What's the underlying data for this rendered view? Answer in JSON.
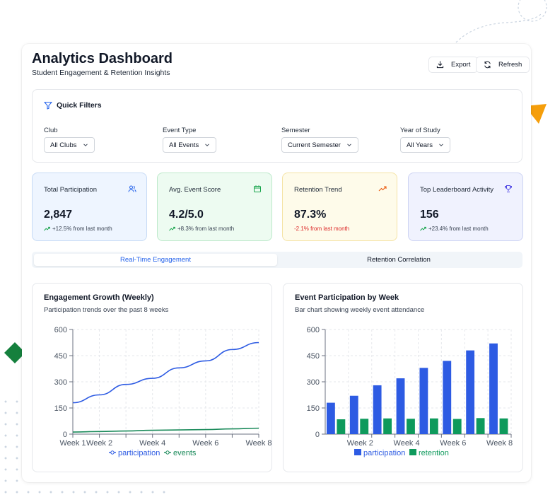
{
  "header": {
    "title": "Analytics Dashboard",
    "subtitle": "Student Engagement & Retention Insights",
    "export_label": "Export",
    "refresh_label": "Refresh"
  },
  "filters": {
    "title": "Quick Filters",
    "items": [
      {
        "label": "Club",
        "value": "All Clubs"
      },
      {
        "label": "Event Type",
        "value": "All Events"
      },
      {
        "label": "Semester",
        "value": "Current Semester"
      },
      {
        "label": "Year of Study",
        "value": "All Years"
      }
    ]
  },
  "metrics": [
    {
      "label": "Total Participation",
      "value": "2,847",
      "change": "+12.5% from last month",
      "icon": "users-icon",
      "trend": "up"
    },
    {
      "label": "Avg. Event Score",
      "value": "4.2/5.0",
      "change": "+8.3% from last month",
      "icon": "calendar-icon",
      "trend": "up"
    },
    {
      "label": "Retention Trend",
      "value": "87.3%",
      "change": "-2.1% from last month",
      "icon": "trending-up-icon",
      "trend": "down"
    },
    {
      "label": "Top Leaderboard Activity",
      "value": "156",
      "change": "+23.4% from last month",
      "icon": "trophy-icon",
      "trend": "up"
    }
  ],
  "tabs": [
    {
      "label": "Real-Time Engagement",
      "active": true
    },
    {
      "label": "Retention Correlation",
      "active": false
    }
  ],
  "colors": {
    "participation": "#2d5be3",
    "events": "#1a8a5a",
    "retention": "#0e9a5c",
    "accent": "#2563eb",
    "negative": "#dc2626"
  },
  "chart_data": [
    {
      "type": "line",
      "title": "Engagement Growth (Weekly)",
      "subtitle": "Participation trends over the past 8 weeks",
      "x": [
        "Week 1",
        "Week 2",
        "Week 3",
        "Week 4",
        "Week 5",
        "Week 6",
        "Week 7",
        "Week 8"
      ],
      "tick_labels": [
        "Week 1",
        "Week 2",
        "Week 4",
        "Week 6",
        "Week 8"
      ],
      "y_ticks": [
        "0",
        "150",
        "300",
        "450",
        "600"
      ],
      "ylim": [
        0,
        600
      ],
      "grid": true,
      "legend": "bottom",
      "series": [
        {
          "name": "participation",
          "values": [
            180,
            225,
            285,
            320,
            380,
            420,
            485,
            525
          ]
        },
        {
          "name": "events",
          "values": [
            12,
            15,
            18,
            22,
            24,
            26,
            30,
            34
          ]
        }
      ]
    },
    {
      "type": "bar",
      "title": "Event Participation by Week",
      "subtitle": "Bar chart showing weekly event attendance",
      "categories": [
        "Week 1",
        "Week 2",
        "Week 3",
        "Week 4",
        "Week 5",
        "Week 6",
        "Week 7",
        "Week 8"
      ],
      "tick_labels": [
        "Week 2",
        "Week 4",
        "Week 6",
        "Week 8"
      ],
      "y_ticks": [
        "0",
        "150",
        "300",
        "450",
        "600"
      ],
      "ylim": [
        0,
        600
      ],
      "grid": true,
      "legend": "bottom",
      "series": [
        {
          "name": "participation",
          "values": [
            180,
            220,
            280,
            320,
            380,
            420,
            480,
            520
          ]
        },
        {
          "name": "retention",
          "values": [
            85,
            88,
            90,
            88,
            90,
            87,
            92,
            90
          ]
        }
      ]
    }
  ]
}
